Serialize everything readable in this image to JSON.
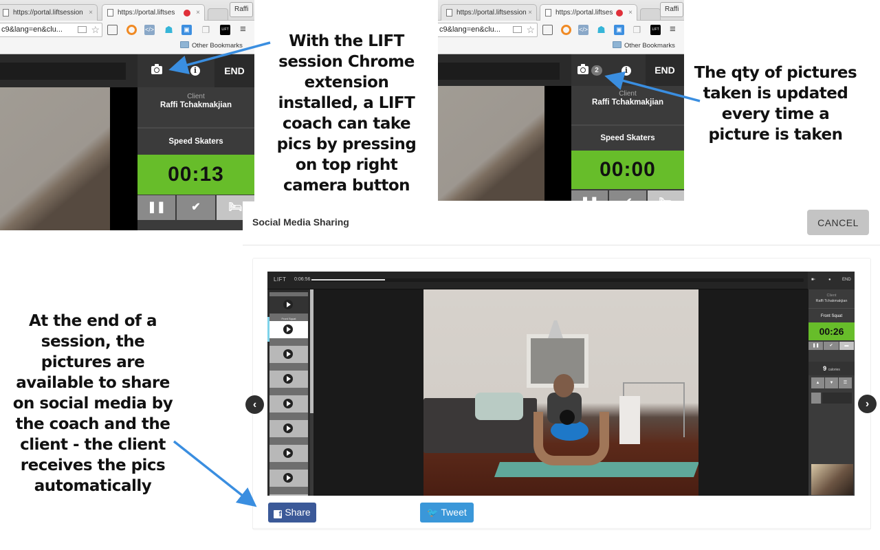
{
  "screenshot_left": {
    "tabs": [
      {
        "label": "https://portal.liftsession",
        "active": false
      },
      {
        "label": "https://portal.liftses",
        "active": true
      }
    ],
    "profile": "Raffi",
    "omnibox": "c9&lang=en&clu...",
    "bookmarks_folder": "Other Bookmarks",
    "extension_label": "LIFT",
    "end_label": "END",
    "client_label": "Client",
    "client_name": "Raffi Tchakmakjian",
    "exercise": "Speed Skaters",
    "timer": "00:13",
    "controls": [
      "pause-icon",
      "check-icon",
      "rest-bed-icon"
    ]
  },
  "screenshot_right": {
    "tabs": [
      {
        "label": "https://portal.liftsession",
        "active": false
      },
      {
        "label": "https://portal.liftses",
        "active": true
      }
    ],
    "profile": "Raffi",
    "omnibox": "c9&lang=en&clu...",
    "bookmarks_folder": "Other Bookmarks",
    "extension_label": "LIFT",
    "end_label": "END",
    "picture_count": "2",
    "client_label": "Client",
    "client_name": "Raffi Tchakmakjian",
    "exercise": "Speed Skaters",
    "timer": "00:00"
  },
  "annotations": {
    "camera_note": "With the LIFT session Chrome extension installed, a LIFT coach can take pics by pressing on top right camera button",
    "count_note": "The qty of pictures taken is updated every time a picture is taken",
    "sharing_note": "At the end of a session, the pictures are available to share on social media by the coach and the client - the client receives the pics automatically"
  },
  "modal": {
    "title": "Social Media Sharing",
    "cancel_label": "CANCEL",
    "prev_label": "‹",
    "next_label": "›",
    "share_label": "Share",
    "tweet_label": "Tweet",
    "colors": {
      "facebook": "#3b5998",
      "twitter": "#3a97d9",
      "timer_green": "#67bd2a"
    },
    "picture": {
      "logo": "LIFT",
      "elapsed": "0:06:56",
      "progress": 0.15,
      "end_label": "END",
      "client_label": "Client",
      "client_name": "Raffi Tchakmakjian",
      "exercise": "Front Squat",
      "timer": "00:26",
      "calories_value": "9",
      "calories_label": "calories",
      "playlist": [
        "",
        "Front Squat",
        "",
        "",
        "",
        "",
        "",
        "",
        ""
      ]
    }
  }
}
